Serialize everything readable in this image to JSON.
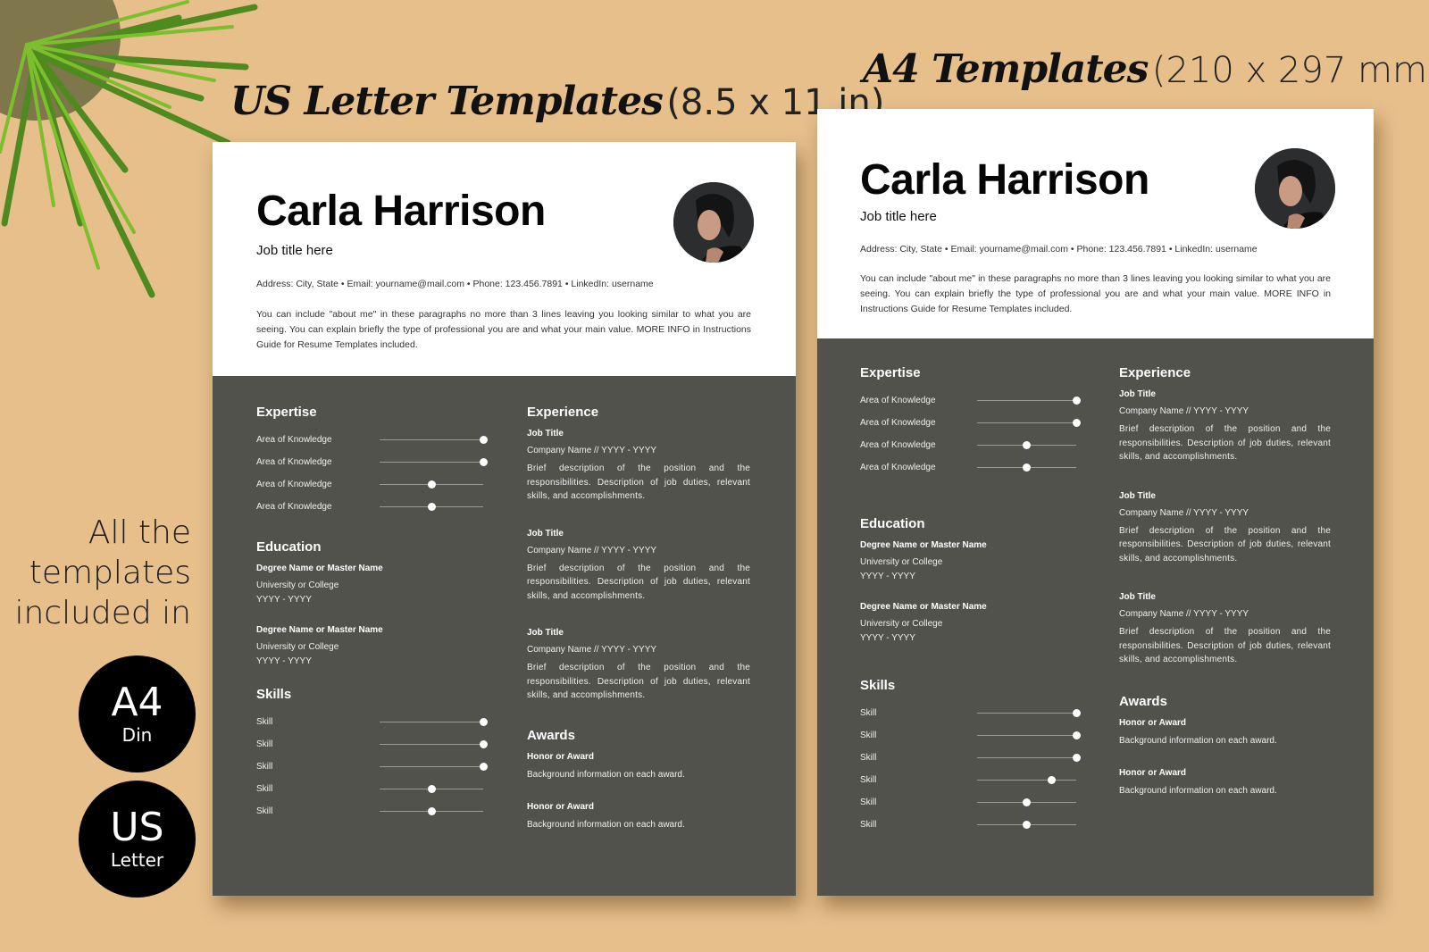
{
  "headings": {
    "us": {
      "script": "US Letter Templates",
      "dims": "(8.5 x 11 in)"
    },
    "a4": {
      "script": "A4 Templates",
      "dims": "(210 x 297 mm)"
    }
  },
  "promo": {
    "lines": [
      "All the",
      "templates",
      "included in"
    ],
    "badges": [
      {
        "big": "A4",
        "small": "Din"
      },
      {
        "big": "US",
        "small": "Letter"
      }
    ]
  },
  "colors": {
    "background": "#e6bf8b",
    "dark_panel": "#52524c",
    "badge": "#000000"
  },
  "resume": {
    "name": "Carla Harrison",
    "job_title": "Job title here",
    "contact": "Address: City, State  •  Email: yourname@mail.com  •  Phone: 123.456.7891  •  LinkedIn: username",
    "about": "You can include \"about me\" in these paragraphs no more than 3 lines leaving you looking similar to what you are seeing. You can explain briefly the type of professional you are and what your main value. MORE INFO in Instructions Guide for Resume Templates included.",
    "sections": {
      "expertise": "Expertise",
      "education": "Education",
      "skills": "Skills",
      "experience": "Experience",
      "awards": "Awards"
    },
    "expertise_label": "Area of Knowledge",
    "skill_label": "Skill",
    "education": [
      {
        "degree": "Degree Name or Master Name",
        "school": "University or College",
        "years": "YYYY - YYYY"
      },
      {
        "degree": "Degree Name or Master Name",
        "school": "University or College",
        "years": "YYYY - YYYY"
      }
    ],
    "experience": [
      {
        "title": "Job Title",
        "company": "Company Name // YYYY - YYYY",
        "desc": "Brief description of the position and the responsibilities. Description of job duties, relevant skills, and accomplishments."
      },
      {
        "title": "Job Title",
        "company": "Company Name // YYYY - YYYY",
        "desc": "Brief description of the position and the responsibilities. Description of job duties, relevant skills, and accomplishments."
      },
      {
        "title": "Job Title",
        "company": "Company Name // YYYY - YYYY",
        "desc": "Brief description of the position and the responsibilities. Description of job duties, relevant skills, and accomplishments."
      }
    ],
    "awards": [
      {
        "title": "Honor or Award",
        "desc": "Background information on each award."
      },
      {
        "title": "Honor or Award",
        "desc": "Background information on each award."
      }
    ]
  },
  "documents": {
    "us": {
      "expertise_levels": [
        1,
        1,
        0.5,
        0.5
      ],
      "skill_levels": [
        1,
        1,
        1,
        0.5,
        0.5
      ]
    },
    "a4": {
      "expertise_levels": [
        1,
        1,
        0.5,
        0.5
      ],
      "skill_levels": [
        1,
        1,
        1,
        0.75,
        0.5,
        0.5
      ]
    }
  }
}
